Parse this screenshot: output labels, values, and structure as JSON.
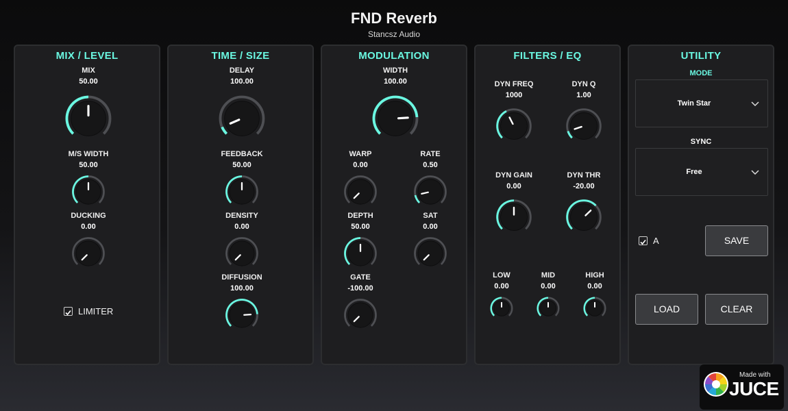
{
  "header": {
    "title": "FND Reverb",
    "subtitle": "Stancsz Audio"
  },
  "colors": {
    "accent": "#6af7e1",
    "track": "#4e4f53",
    "panel_bg": "#1e1e20"
  },
  "panels": {
    "mix": {
      "title": "MIX / LEVEL",
      "knobs": {
        "mix": {
          "label": "MIX",
          "value": "50.00",
          "norm": 0.5
        },
        "ms_width": {
          "label": "M/S WIDTH",
          "value": "50.00",
          "norm": 0.5
        },
        "ducking": {
          "label": "DUCKING",
          "value": "0.00",
          "norm": 0.0
        }
      },
      "limiter": {
        "label": "LIMITER",
        "checked": true
      }
    },
    "time": {
      "title": "TIME / SIZE",
      "knobs": {
        "delay": {
          "label": "DELAY",
          "value": "100.00",
          "norm": 0.08
        },
        "feedback": {
          "label": "FEEDBACK",
          "value": "50.00",
          "norm": 0.5
        },
        "density": {
          "label": "DENSITY",
          "value": "0.00",
          "norm": 0.0
        },
        "diffusion": {
          "label": "DIFFUSION",
          "value": "100.00",
          "norm": 0.82
        }
      }
    },
    "modulation": {
      "title": "MODULATION",
      "knobs": {
        "width": {
          "label": "WIDTH",
          "value": "100.00",
          "norm": 0.82
        },
        "warp": {
          "label": "WARP",
          "value": "0.00",
          "norm": 0.0
        },
        "rate": {
          "label": "RATE",
          "value": "0.50",
          "norm": 0.12
        },
        "depth": {
          "label": "DEPTH",
          "value": "50.00",
          "norm": 0.5
        },
        "sat": {
          "label": "SAT",
          "value": "0.00",
          "norm": 0.0
        },
        "gate": {
          "label": "GATE",
          "value": "-100.00",
          "norm": 0.0
        }
      }
    },
    "filters": {
      "title": "FILTERS / EQ",
      "knobs": {
        "dyn_freq": {
          "label": "DYN FREQ",
          "value": "1000",
          "norm": 0.4
        },
        "dyn_q": {
          "label": "DYN Q",
          "value": "1.00",
          "norm": 0.1
        },
        "dyn_gain": {
          "label": "DYN GAIN",
          "value": "0.00",
          "norm": 0.5
        },
        "dyn_thr": {
          "label": "DYN THR",
          "value": "-20.00",
          "norm": 0.67
        },
        "low": {
          "label": "LOW",
          "value": "0.00",
          "norm": 0.5
        },
        "mid": {
          "label": "MID",
          "value": "0.00",
          "norm": 0.5
        },
        "high": {
          "label": "HIGH",
          "value": "0.00",
          "norm": 0.5
        }
      }
    },
    "utility": {
      "title": "UTILITY",
      "mode_label": "MODE",
      "mode_value": "Twin Star",
      "sync_label": "SYNC",
      "sync_value": "Free",
      "a_toggle": {
        "label": "A",
        "checked": true
      },
      "save_label": "SAVE",
      "load_label": "LOAD",
      "clear_label": "CLEAR"
    }
  },
  "badge": {
    "line1": "Made with",
    "line2": "JUCE"
  }
}
